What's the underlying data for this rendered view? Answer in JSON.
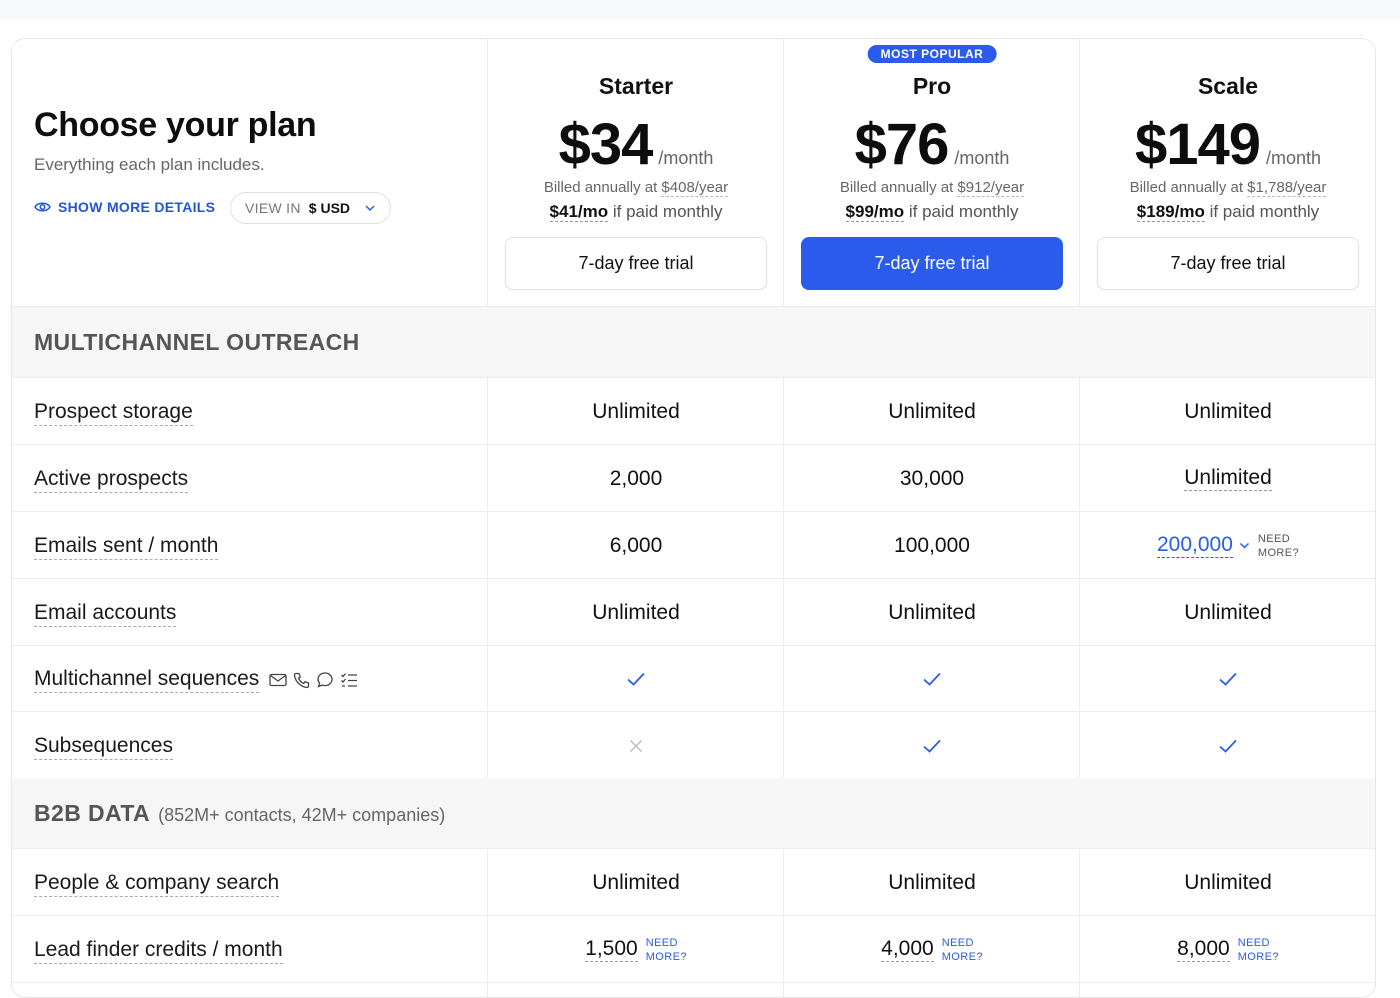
{
  "intro": {
    "title": "Choose your plan",
    "subtitle": "Everything each plan includes.",
    "show_more": "SHOW MORE DETAILS",
    "view_in_label": "VIEW IN",
    "currency": "$ USD"
  },
  "plans": [
    {
      "name": "Starter",
      "price": "$34",
      "per": "/month",
      "billed_prefix": "Billed annually at ",
      "billed_amount": "$408/year",
      "monthly_price": "$41/mo",
      "monthly_suffix": " if paid monthly",
      "cta": "7-day free trial"
    },
    {
      "name": "Pro",
      "badge": "MOST POPULAR",
      "price": "$76",
      "per": "/month",
      "billed_prefix": "Billed annually at ",
      "billed_amount": "$912/year",
      "monthly_price": "$99/mo",
      "monthly_suffix": " if paid monthly",
      "cta": "7-day free trial"
    },
    {
      "name": "Scale",
      "price": "$149",
      "per": "/month",
      "billed_prefix": "Billed annually at ",
      "billed_amount": "$1,788/year",
      "monthly_price": "$189/mo",
      "monthly_suffix": " if paid monthly",
      "cta": "7-day free trial"
    }
  ],
  "sections": {
    "multichannel": {
      "title": "MULTICHANNEL OUTREACH"
    },
    "b2b": {
      "title": "B2B DATA",
      "note": "(852M+ contacts, 42M+ companies)"
    }
  },
  "rows": [
    {
      "label": "Prospect storage",
      "values": [
        "Unlimited",
        "Unlimited",
        "Unlimited"
      ]
    },
    {
      "label": "Active prospects",
      "values": [
        "2,000",
        "30,000",
        "Unlimited"
      ]
    },
    {
      "label": "Emails sent / month",
      "values": [
        "6,000",
        "100,000",
        "200,000"
      ]
    },
    {
      "label": "Email accounts",
      "values": [
        "Unlimited",
        "Unlimited",
        "Unlimited"
      ]
    },
    {
      "label": "Multichannel sequences"
    },
    {
      "label": "Subsequences"
    },
    {
      "label": "People & company search",
      "values": [
        "Unlimited",
        "Unlimited",
        "Unlimited"
      ]
    },
    {
      "label": "Lead finder credits / month",
      "values": [
        "1,500",
        "4,000",
        "8,000"
      ]
    }
  ],
  "need_more": {
    "line1": "NEED",
    "line2": "MORE?"
  },
  "colors": {
    "accent": "#2b5bea",
    "check": "#2b5bea",
    "cross": "#bdbdbd"
  }
}
